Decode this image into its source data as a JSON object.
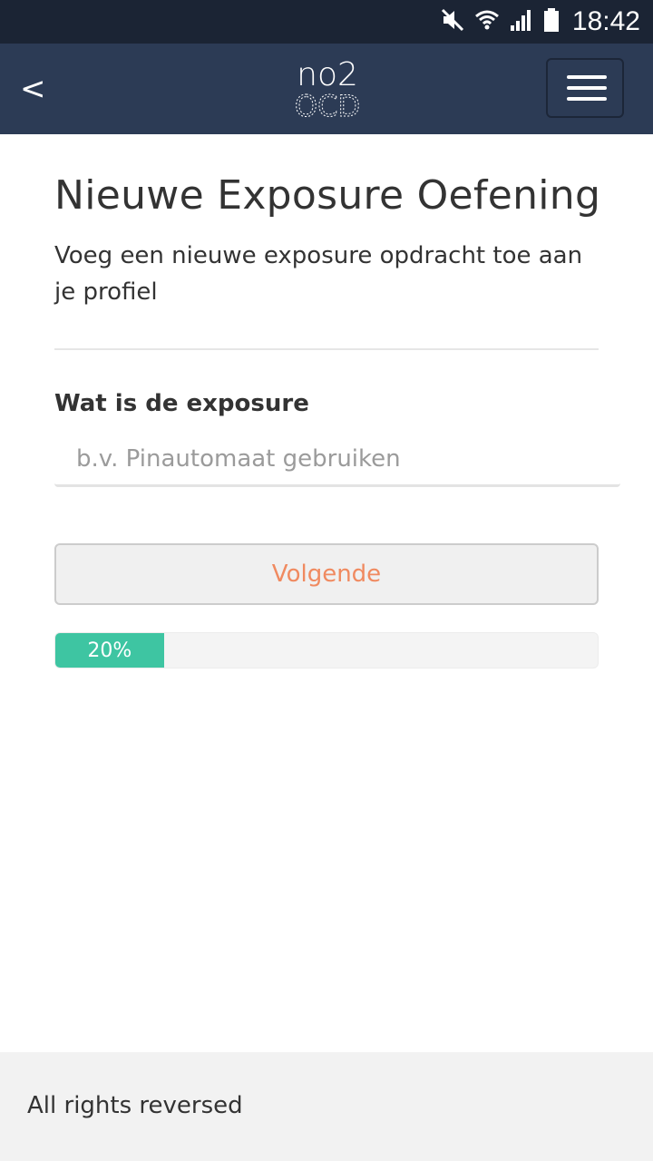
{
  "status_bar": {
    "time": "18:42",
    "icons": [
      "mute-icon",
      "wifi-icon",
      "signal-icon",
      "battery-icon"
    ]
  },
  "nav": {
    "back_label": "<",
    "logo_top": "no2",
    "logo_bottom": "OCD",
    "menu_icon": "hamburger-menu-icon"
  },
  "page": {
    "title": "Nieuwe Exposure Oefening",
    "subtitle": "Voeg een nieuwe exposure opdracht toe aan je profiel"
  },
  "form": {
    "label": "Wat is de exposure",
    "input_value": "",
    "input_placeholder": "b.v. Pinautomaat gebruiken",
    "next_button_label": "Volgende"
  },
  "progress": {
    "value": 0.2,
    "label": "20%"
  },
  "footer": {
    "text": "All rights reversed"
  },
  "colors": {
    "statusbar_bg": "#1b2434",
    "navbar_bg": "#2c3b55",
    "accent_orange": "#f08a60",
    "progress_green": "#3ec5a2",
    "footer_bg": "#f2f2f2"
  }
}
